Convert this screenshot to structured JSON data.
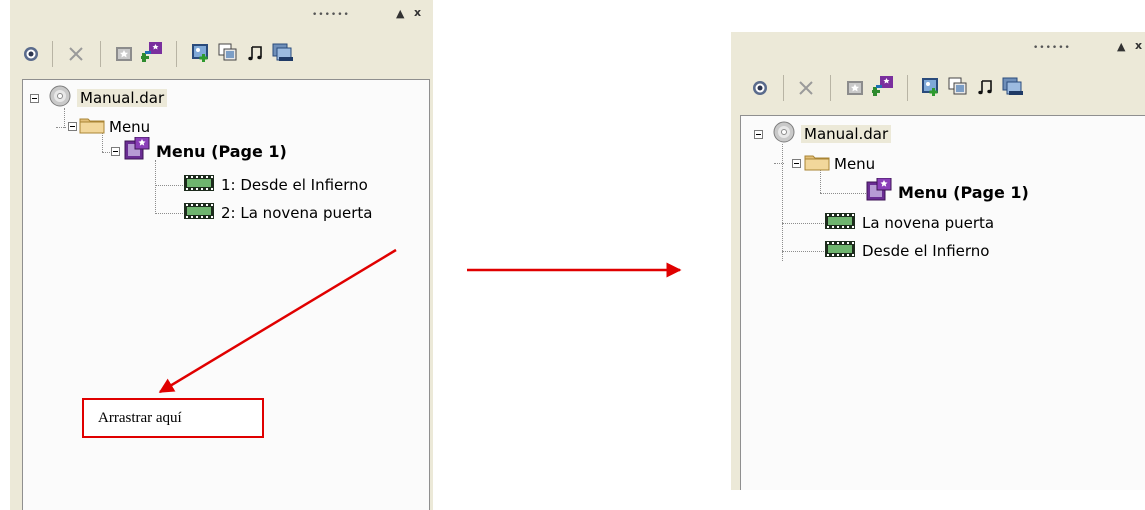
{
  "before": {
    "panel_controls": {
      "grip": "••••••",
      "collapse": "▲",
      "close": "x"
    },
    "toolbar": {
      "icons": [
        "target-icon",
        "delete-icon",
        "menu-icon",
        "submenu-icon",
        "add-picture-icon",
        "copy-icon",
        "music-icon",
        "slideshow-icon"
      ]
    },
    "tree": {
      "root": "Manual.dar",
      "folder": "Menu",
      "menu_page": "Menu (Page 1)",
      "movie_1": "1: Desde el Infierno",
      "movie_2": "2: La novena puerta"
    }
  },
  "annotation": {
    "text": "Arrastrar aquí",
    "arrow_color": "#e00000"
  },
  "after": {
    "panel_controls": {
      "grip": "••••••",
      "collapse": "▲",
      "close": "x"
    },
    "toolbar": {
      "icons": [
        "target-icon",
        "delete-icon",
        "menu-icon",
        "submenu-icon",
        "add-picture-icon",
        "copy-icon",
        "music-icon",
        "slideshow-icon"
      ]
    },
    "tree": {
      "root": "Manual.dar",
      "folder": "Menu",
      "menu_page": "Menu (Page 1)",
      "movie_1": "La novena puerta",
      "movie_2": "Desde el Infierno"
    }
  }
}
